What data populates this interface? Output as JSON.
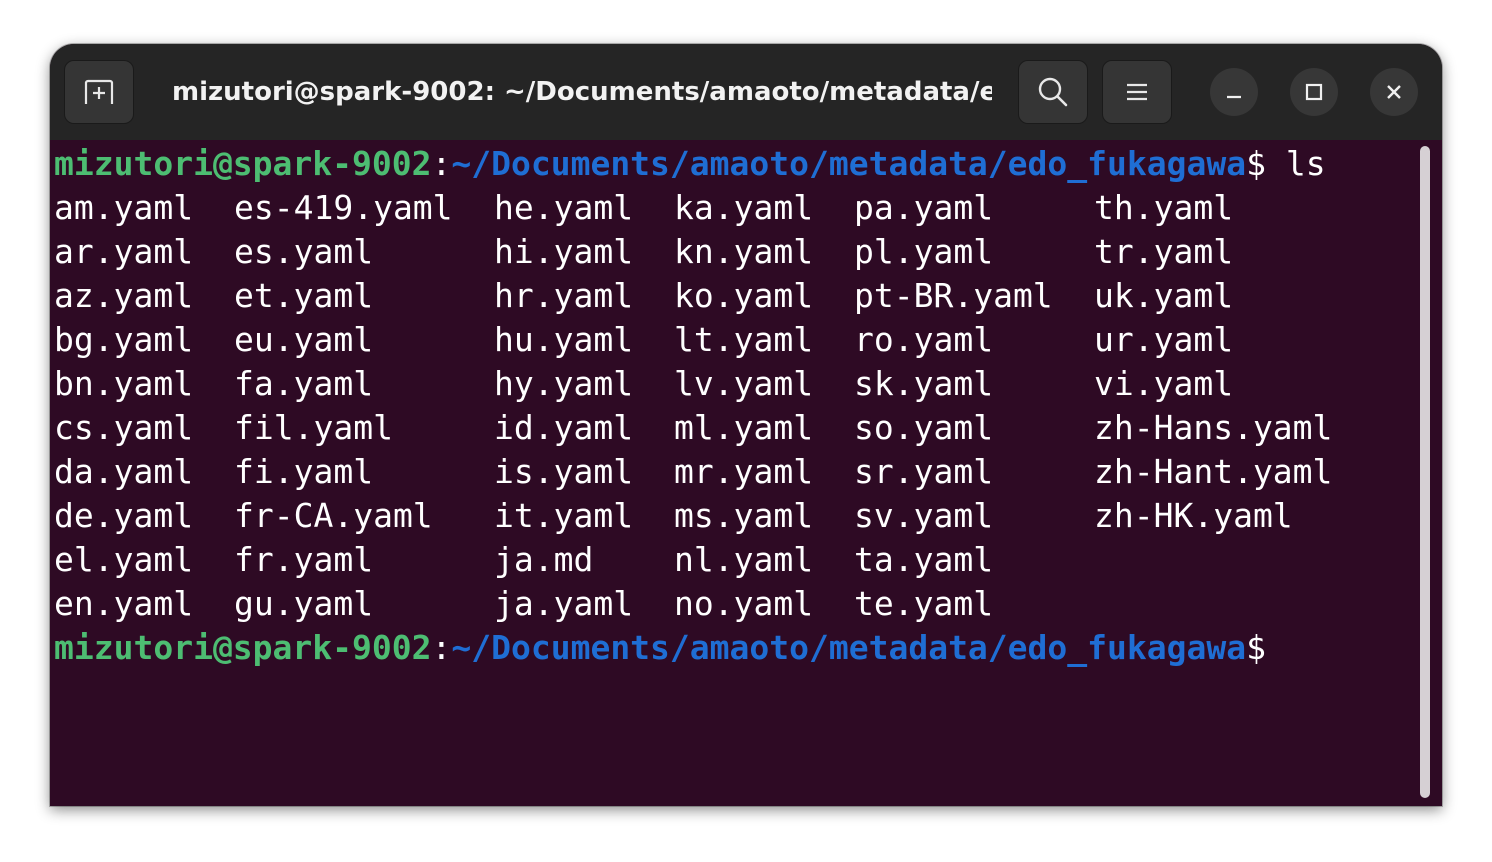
{
  "window": {
    "title": "mizutori@spark-9002: ~/Documents/amaoto/metadata/e…"
  },
  "icons": {
    "new_tab": "new-tab-icon",
    "search": "search-icon",
    "menu": "hamburger-menu-icon",
    "minimize": "minimize-icon",
    "maximize": "maximize-icon",
    "close": "close-icon"
  },
  "colors": {
    "terminal_bg": "#2e0a24",
    "titlebar_bg": "#252525",
    "prompt_user": "#4dbd72",
    "prompt_path": "#1f6ed4",
    "text": "#ffffff"
  },
  "terminal": {
    "prompt1": {
      "user": "mizutori@spark-9002",
      "sep": ":",
      "path": "~/Documents/amaoto/metadata/edo_fukagawa",
      "symbol": "$ ",
      "command": "ls"
    },
    "listing": [
      [
        "am.yaml",
        "es-419.yaml",
        "he.yaml",
        "ka.yaml",
        "pa.yaml",
        "th.yaml"
      ],
      [
        "ar.yaml",
        "es.yaml",
        "hi.yaml",
        "kn.yaml",
        "pl.yaml",
        "tr.yaml"
      ],
      [
        "az.yaml",
        "et.yaml",
        "hr.yaml",
        "ko.yaml",
        "pt-BR.yaml",
        "uk.yaml"
      ],
      [
        "bg.yaml",
        "eu.yaml",
        "hu.yaml",
        "lt.yaml",
        "ro.yaml",
        "ur.yaml"
      ],
      [
        "bn.yaml",
        "fa.yaml",
        "hy.yaml",
        "lv.yaml",
        "sk.yaml",
        "vi.yaml"
      ],
      [
        "cs.yaml",
        "fil.yaml",
        "id.yaml",
        "ml.yaml",
        "so.yaml",
        "zh-Hans.yaml"
      ],
      [
        "da.yaml",
        "fi.yaml",
        "is.yaml",
        "mr.yaml",
        "sr.yaml",
        "zh-Hant.yaml"
      ],
      [
        "de.yaml",
        "fr-CA.yaml",
        "it.yaml",
        "ms.yaml",
        "sv.yaml",
        "zh-HK.yaml"
      ],
      [
        "el.yaml",
        "fr.yaml",
        "ja.md",
        "nl.yaml",
        "ta.yaml",
        ""
      ],
      [
        "en.yaml",
        "gu.yaml",
        "ja.yaml",
        "no.yaml",
        "te.yaml",
        ""
      ]
    ],
    "prompt2": {
      "user": "mizutori@spark-9002",
      "sep": ":",
      "path": "~/Documents/amaoto/metadata/edo_fukagawa",
      "symbol": "$"
    }
  }
}
